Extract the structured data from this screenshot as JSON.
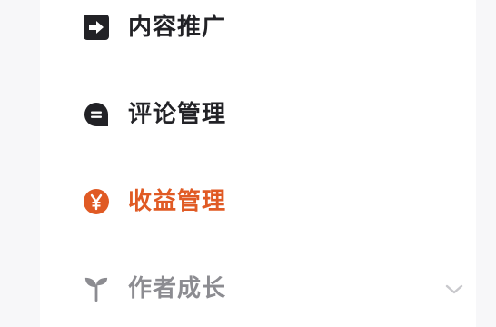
{
  "menu": {
    "items": [
      {
        "label": "内容推广",
        "icon": "arrow-right-box-icon",
        "state": "default"
      },
      {
        "label": "评论管理",
        "icon": "comment-bubble-icon",
        "state": "default"
      },
      {
        "label": "收益管理",
        "icon": "yen-coin-icon",
        "state": "active"
      },
      {
        "label": "作者成长",
        "icon": "sprout-icon",
        "state": "collapsed",
        "has_chevron": true
      }
    ]
  },
  "colors": {
    "background": "#f7f7f9",
    "panel": "#ffffff",
    "text_default": "#222226",
    "text_active": "#e05a24",
    "text_muted": "#8c8c91",
    "chevron": "#c8c8cc"
  }
}
